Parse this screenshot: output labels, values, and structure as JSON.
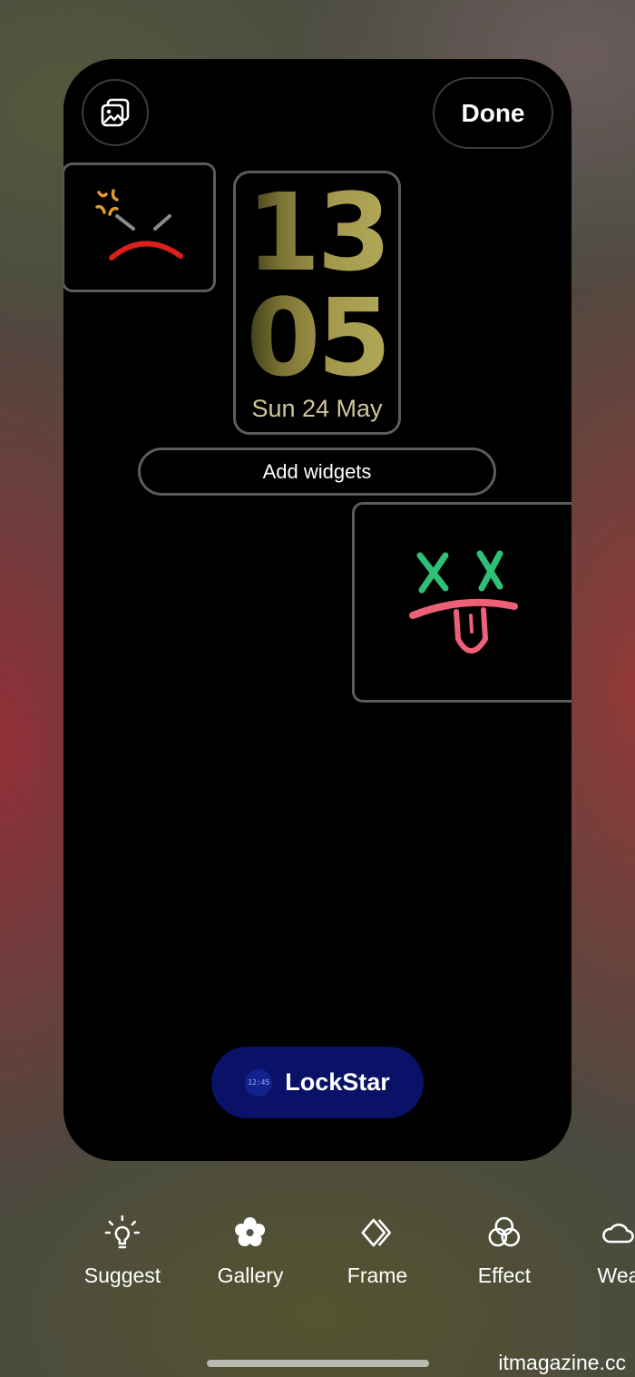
{
  "header": {
    "wallpaper_button_icon": "gallery-image-icon",
    "done_label": "Done"
  },
  "widgets": {
    "angry_sticker_icon": "angry-face-icon",
    "clock": {
      "hours": "13",
      "minutes": "05",
      "date": "Sun 24 May",
      "color": "#a39a4e"
    },
    "add_widgets_label": "Add widgets",
    "dizzy_sticker_icon": "dizzy-tongue-face-icon"
  },
  "lockstar": {
    "label": "LockStar",
    "icon_time": "12:45",
    "background_color": "#091266"
  },
  "toolbar": {
    "items": [
      {
        "label": "Suggest",
        "icon": "lightbulb-icon"
      },
      {
        "label": "Gallery",
        "icon": "flower-icon"
      },
      {
        "label": "Frame",
        "icon": "frame-icon"
      },
      {
        "label": "Effect",
        "icon": "effect-circles-icon"
      },
      {
        "label": "Wea",
        "icon": "weather-icon"
      }
    ]
  },
  "watermark": "itmagazine.cc"
}
